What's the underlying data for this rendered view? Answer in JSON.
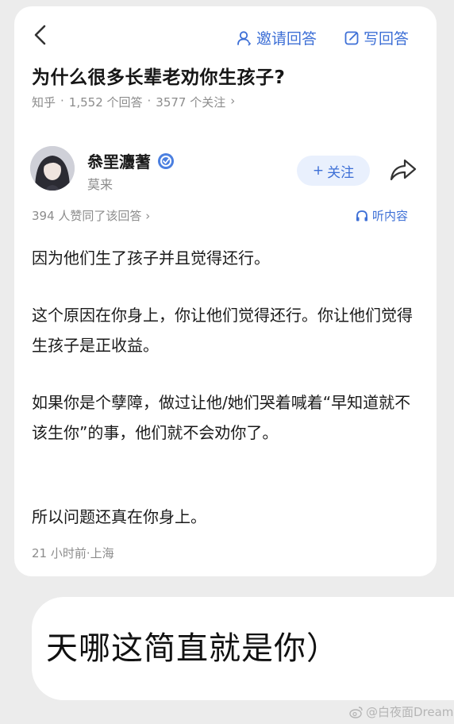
{
  "header": {
    "invite_label": "邀请回答",
    "write_label": "写回答"
  },
  "question": {
    "title": "为什么很多长辈老劝你生孩子?",
    "source": "知乎",
    "answers": "1,552 个回答",
    "followers": "3577 个关注"
  },
  "answer": {
    "author_name": "叅罜灋蓍",
    "author_sub": "莫来",
    "follow_label": "关注",
    "votes": "394 人赞同了该回答",
    "listen_label": "听内容",
    "paragraphs": [
      "因为他们生了孩子并且觉得还行。",
      "这个原因在你身上，你让他们觉得还行。你让他们觉得生孩子是正收益。",
      "如果你是个孽障，做过让他/她们哭着喊着“早知道就不该生你”的事，他们就不会劝你了。",
      "所以问题还真在你身上。"
    ],
    "time": "21 小时前·上海"
  },
  "caption": "天哪这简直就是你）",
  "watermark": "@白夜面Dream",
  "colors": {
    "accent": "#3d6fd6",
    "follow_bg": "#e9f0fd",
    "muted": "#8c8c8c",
    "background": "#ececec"
  },
  "icons": [
    "back-arrow-icon",
    "person-icon",
    "edit-icon",
    "verified-badge-icon",
    "share-icon",
    "headphones-icon",
    "chevron-right-icon",
    "weibo-icon"
  ]
}
